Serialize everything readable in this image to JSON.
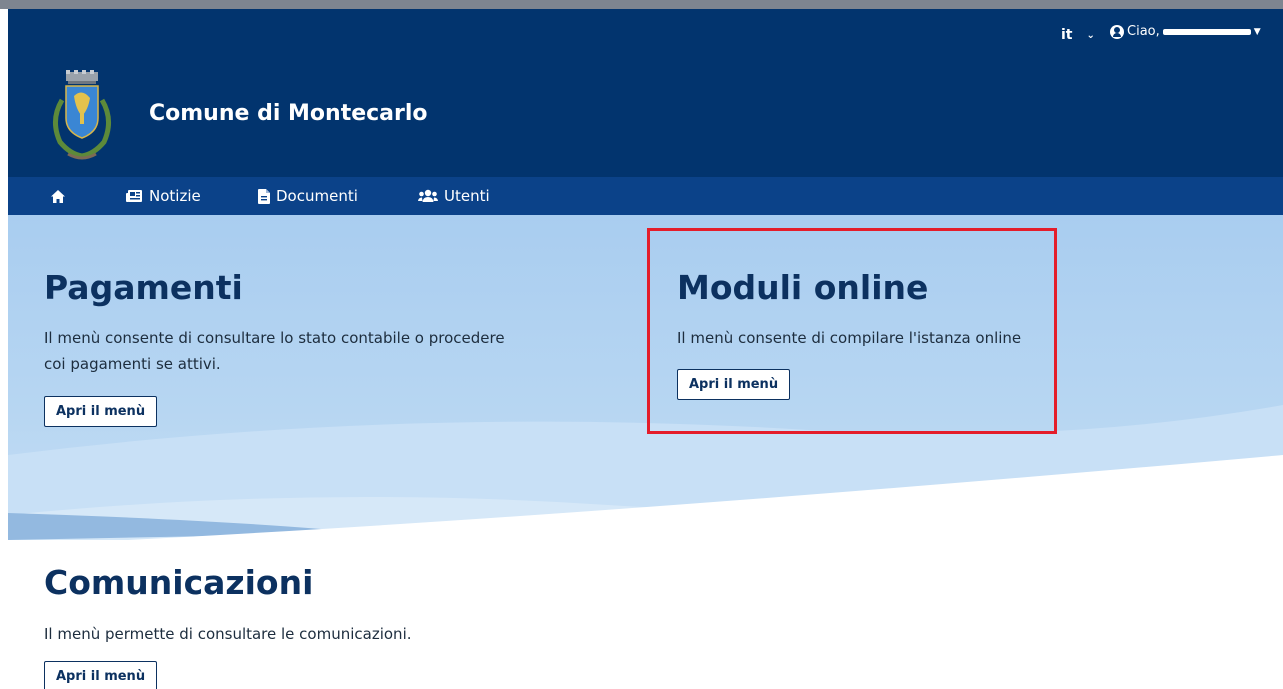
{
  "header": {
    "language": "it",
    "greeting": "Ciao,",
    "site_title": "Comune di Montecarlo",
    "logo_icon": "crest-icon"
  },
  "nav": {
    "items": [
      {
        "label": "",
        "icon": "home-icon"
      },
      {
        "label": "Notizie",
        "icon": "newspaper-icon"
      },
      {
        "label": "Documenti",
        "icon": "document-icon"
      },
      {
        "label": "Utenti",
        "icon": "users-icon"
      }
    ]
  },
  "cards": {
    "pagamenti": {
      "title": "Pagamenti",
      "text": "Il menù consente di consultare lo stato contabile o procedere coi pagamenti se attivi.",
      "button": "Apri il menù"
    },
    "moduli": {
      "title": "Moduli online",
      "text": "Il menù consente di compilare l'istanza online",
      "button": "Apri il menù"
    },
    "comunicazioni": {
      "title": "Comunicazioni",
      "text": "Il menù permette di consultare le comunicazioni.",
      "button": "Apri il menù"
    }
  },
  "colors": {
    "header_bg": "#02346e",
    "nav_bg": "#0b4289",
    "hero_bg": "#b7d6f2",
    "title_color": "#0c3160",
    "highlight_border": "#e41d2a"
  }
}
